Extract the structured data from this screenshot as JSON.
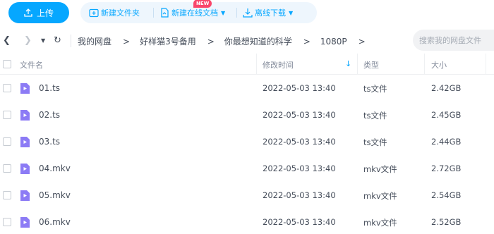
{
  "toolbar": {
    "upload_label": "上传",
    "new_folder_label": "新建文件夹",
    "new_online_doc_label": "新建在线文档",
    "offline_download_label": "离线下载",
    "new_badge": "NEW"
  },
  "nav": {
    "breadcrumb": [
      "我的网盘",
      "好样猫3号备用",
      "你最想知道的科学",
      "1080P"
    ],
    "search_placeholder": "搜索我的网盘文件"
  },
  "table": {
    "headers": {
      "name": "文件名",
      "time": "修改时间",
      "type": "类型",
      "size": "大小"
    },
    "rows": [
      {
        "name": "01.ts",
        "time": "2022-05-03 13:40",
        "type": "ts文件",
        "size": "2.42GB"
      },
      {
        "name": "02.ts",
        "time": "2022-05-03 13:40",
        "type": "ts文件",
        "size": "2.45GB"
      },
      {
        "name": "03.ts",
        "time": "2022-05-03 13:40",
        "type": "ts文件",
        "size": "2.44GB"
      },
      {
        "name": "04.mkv",
        "time": "2022-05-03 13:40",
        "type": "mkv文件",
        "size": "2.72GB"
      },
      {
        "name": "05.mkv",
        "time": "2022-05-03 13:40",
        "type": "mkv文件",
        "size": "2.54GB"
      },
      {
        "name": "06.mkv",
        "time": "2022-05-03 13:40",
        "type": "mkv文件",
        "size": "2.52GB"
      }
    ]
  },
  "colors": {
    "accent": "#06a7ff",
    "video_icon": "#8c7bf5",
    "badge": "#f9466a"
  }
}
